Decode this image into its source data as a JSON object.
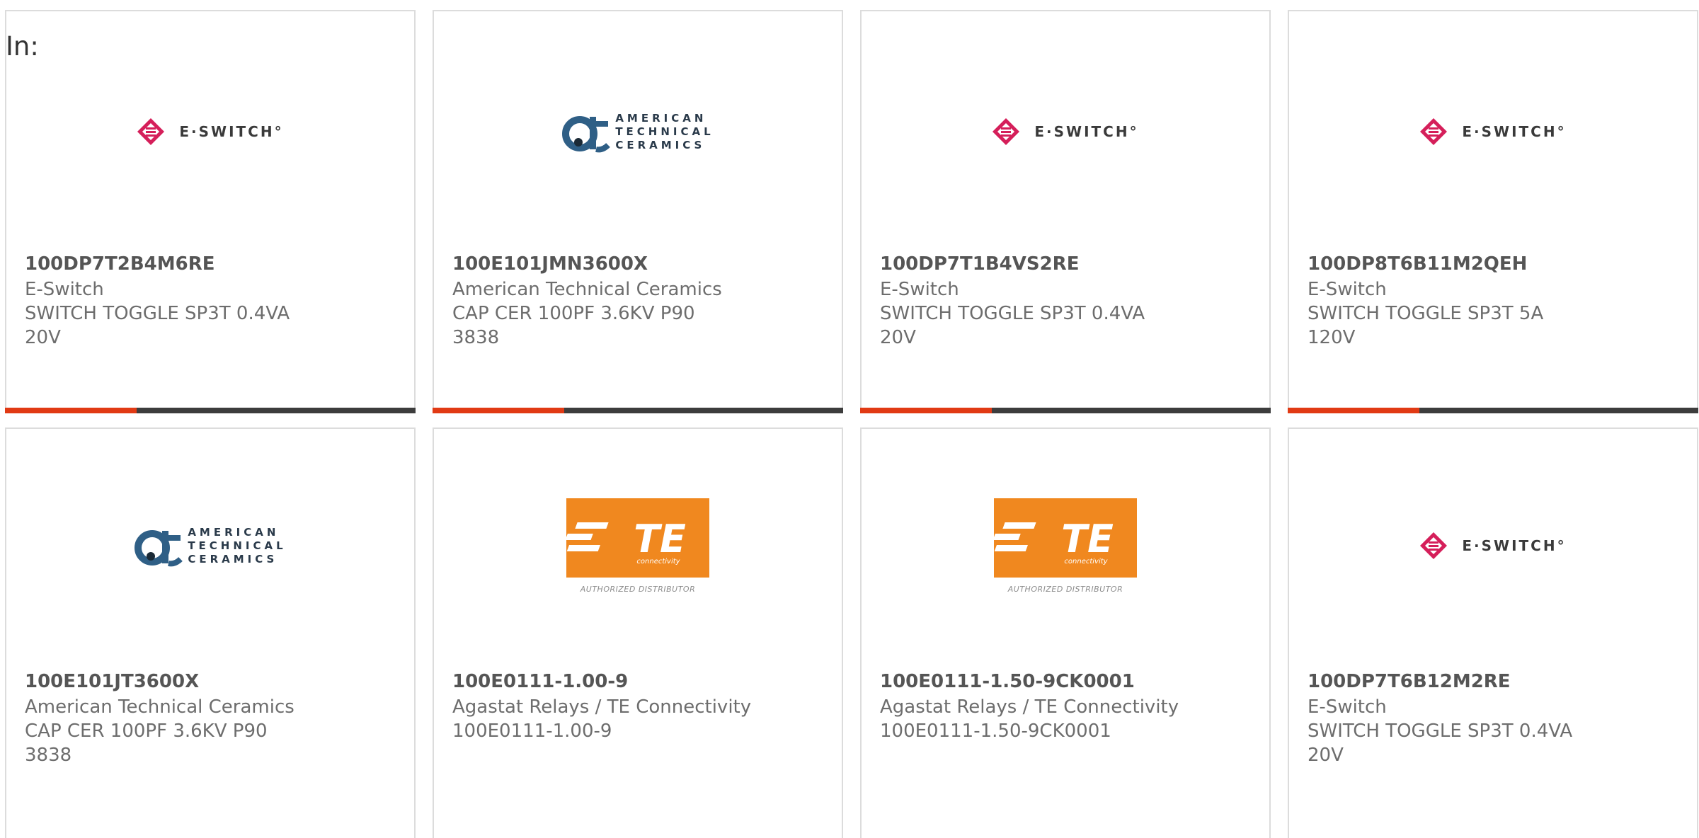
{
  "prefix_label": "In:",
  "colors": {
    "accent": "#e13a14",
    "bar_bg": "#3d3d3d",
    "te_orange": "#f0881f",
    "eswitch_red": "#d51f5a"
  },
  "logos": {
    "eswitch": {
      "text": "E·SWITCH°"
    },
    "atc": {
      "lines": [
        "AMERICAN",
        "TECHNICAL",
        "CERAMICS"
      ]
    },
    "te": {
      "wordmark": "TE",
      "sub": "connectivity",
      "caption": "AUTHORIZED DISTRIBUTOR"
    }
  },
  "products": [
    {
      "part": "100DP7T2B4M6RE",
      "manufacturer": "E-Switch",
      "description": "SWITCH TOGGLE SP3T 0.4VA 20V",
      "logo": "eswitch",
      "progress": 0.32
    },
    {
      "part": "100E101JMN3600X",
      "manufacturer": "American Technical Ceramics",
      "description": "CAP CER 100PF 3.6KV P90 3838",
      "logo": "atc",
      "progress": 0.32
    },
    {
      "part": "100DP7T1B4VS2RE",
      "manufacturer": "E-Switch",
      "description": "SWITCH TOGGLE SP3T 0.4VA 20V",
      "logo": "eswitch",
      "progress": 0.32
    },
    {
      "part": "100DP8T6B11M2QEH",
      "manufacturer": "E-Switch",
      "description": "SWITCH TOGGLE SP3T 5A 120V",
      "logo": "eswitch",
      "progress": 0.32
    },
    {
      "part": "100E101JT3600X",
      "manufacturer": "American Technical Ceramics",
      "description": "CAP CER 100PF 3.6KV P90 3838",
      "logo": "atc"
    },
    {
      "part": "100E0111-1.00-9",
      "manufacturer": "Agastat Relays / TE Connectivity",
      "description": "100E0111-1.00-9",
      "logo": "te"
    },
    {
      "part": "100E0111-1.50-9CK0001",
      "manufacturer": "Agastat Relays / TE Connectivity",
      "description": "100E0111-1.50-9CK0001",
      "logo": "te"
    },
    {
      "part": "100DP7T6B12M2RE",
      "manufacturer": "E-Switch",
      "description": "SWITCH TOGGLE SP3T 0.4VA 20V",
      "logo": "eswitch"
    }
  ]
}
